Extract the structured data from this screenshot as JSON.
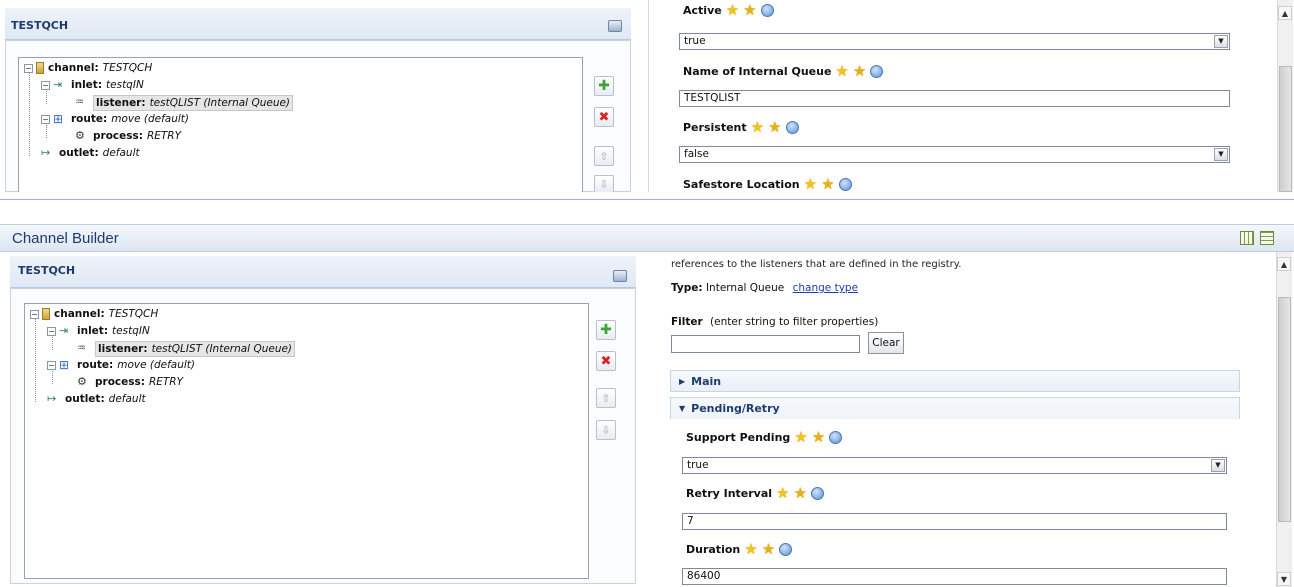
{
  "top_panel": {
    "header_title": "TESTQCH",
    "tree": {
      "channel_label": "channel:",
      "channel_value": "TESTQCH",
      "inlet_label": "inlet:",
      "inlet_value": "testqIN",
      "listener_label": "listener:",
      "listener_value": "testQLIST (Internal Queue)",
      "route_label": "route:",
      "route_value": "move (default)",
      "process_label": "process:",
      "process_value": "RETRY",
      "outlet_label": "outlet:",
      "outlet_value": "default"
    },
    "props": {
      "active_label": "Active",
      "active_value": "true",
      "queue_label": "Name of Internal Queue",
      "queue_value": "TESTQLIST",
      "persistent_label": "Persistent",
      "persistent_value": "false",
      "safestore_label": "Safestore Location"
    }
  },
  "builder": {
    "title": "Channel Builder",
    "header_title": "TESTQCH",
    "tree": {
      "channel_label": "channel:",
      "channel_value": "TESTQCH",
      "inlet_label": "inlet:",
      "inlet_value": "testqIN",
      "listener_label": "listener:",
      "listener_value": "testQLIST (Internal Queue)",
      "route_label": "route:",
      "route_value": "move (default)",
      "process_label": "process:",
      "process_value": "RETRY",
      "outlet_label": "outlet:",
      "outlet_value": "default"
    },
    "description": "references to the listeners that are defined in the registry.",
    "type_label": "Type:",
    "type_value": "Internal Queue",
    "change_type_link": "change type",
    "filter_label": "Filter",
    "filter_hint": "(enter string to filter properties)",
    "filter_value": "",
    "clear_button": "Clear",
    "section_main": "Main",
    "section_pending": "Pending/Retry",
    "props": {
      "support_pending_label": "Support Pending",
      "support_pending_value": "true",
      "retry_interval_label": "Retry Interval",
      "retry_interval_value": "7",
      "duration_label": "Duration",
      "duration_value": "86400"
    }
  },
  "icons": {
    "tree_channel": "channel-icon",
    "tree_inlet": "inlet-icon",
    "tree_listener": "listener-icon",
    "tree_route": "route-icon",
    "tree_process": "process-icon",
    "tree_outlet": "outlet-icon",
    "print": "print-icon",
    "star": "star-icon",
    "help": "help-icon"
  },
  "colors": {
    "header_text": "#1f3b6e",
    "link": "#1b3fb0",
    "delete": "#dd2222",
    "add": "#3aa33a"
  }
}
